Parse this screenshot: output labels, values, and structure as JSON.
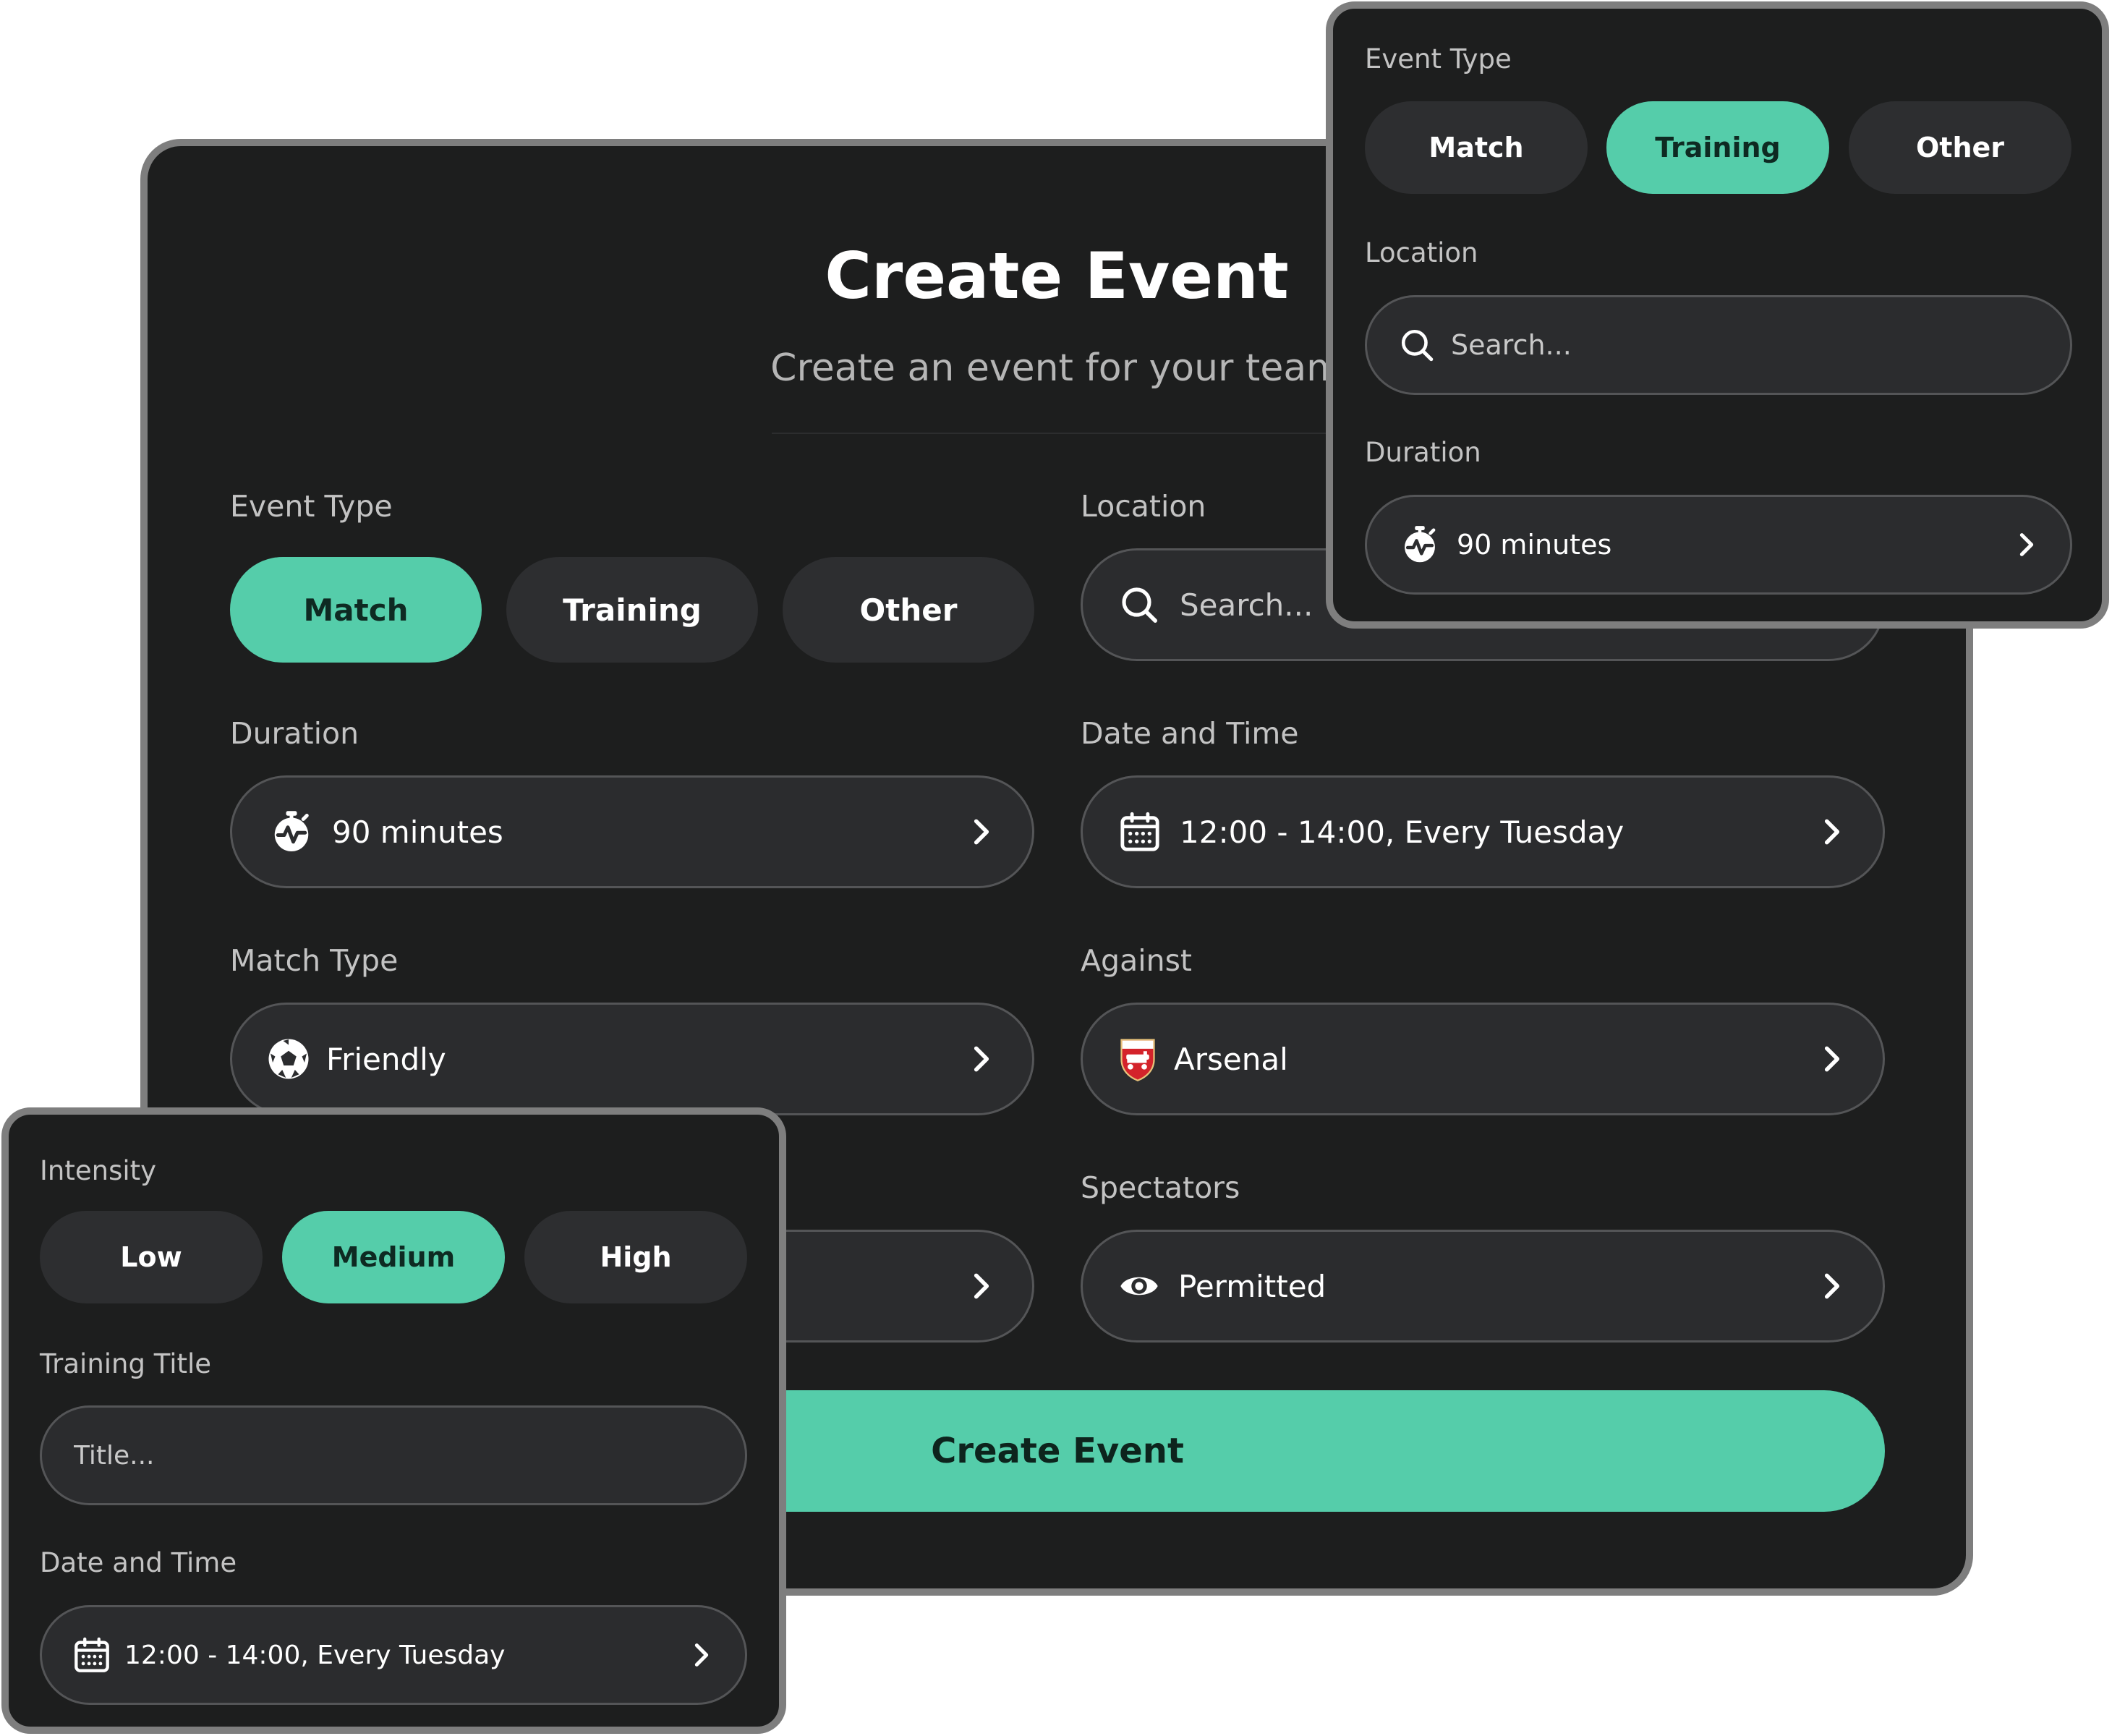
{
  "main": {
    "title": "Create Event",
    "subtitle": "Create an event for your team",
    "event_type": {
      "label": "Event Type",
      "options": [
        "Match",
        "Training",
        "Other"
      ],
      "selected": "Match"
    },
    "location": {
      "label": "Location",
      "placeholder": "Search..."
    },
    "duration": {
      "label": "Duration",
      "value": "90 minutes"
    },
    "date_time": {
      "label": "Date and Time",
      "value": "12:00 - 14:00, Every Tuesday"
    },
    "match_type": {
      "label": "Match Type",
      "value": "Friendly"
    },
    "against": {
      "label": "Against",
      "value": "Arsenal",
      "crest_text": "Arsenal"
    },
    "spectators": {
      "label": "Spectators",
      "value": "Permitted"
    },
    "submit_label": "Create Event"
  },
  "training_panel": {
    "event_type": {
      "label": "Event Type",
      "options": [
        "Match",
        "Training",
        "Other"
      ],
      "selected": "Training"
    },
    "location": {
      "label": "Location",
      "placeholder": "Search..."
    },
    "duration": {
      "label": "Duration",
      "value": "90 minutes"
    }
  },
  "training_details_panel": {
    "intensity": {
      "label": "Intensity",
      "options": [
        "Low",
        "Medium",
        "High"
      ],
      "selected": "Medium"
    },
    "training_title": {
      "label": "Training Title",
      "placeholder": "Title..."
    },
    "date_time": {
      "label": "Date and Time",
      "value": "12:00 - 14:00, Every Tuesday"
    }
  },
  "colors": {
    "accent": "#55cdaa",
    "card_background": "#1d1e1e",
    "field_background": "#2b2c2e",
    "pill_background": "#2d2e30",
    "frame_border": "#7e7e7e",
    "crest_red": "#d4232b"
  },
  "icons": [
    "search-icon",
    "stopwatch-icon",
    "calendar-icon",
    "soccer-ball-icon",
    "arsenal-crest-icon",
    "eye-icon",
    "chevron-right-icon"
  ]
}
